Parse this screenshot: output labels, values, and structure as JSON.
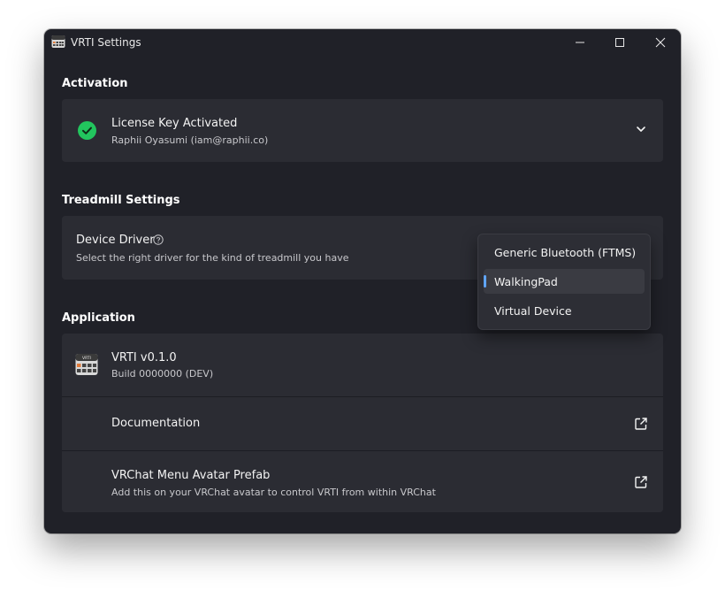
{
  "window": {
    "title": "VRTI Settings"
  },
  "activation": {
    "heading": "Activation",
    "status_title": "License Key Activated",
    "user_line": "Raphii Oyasumi (iam@raphii.co)"
  },
  "treadmill": {
    "heading": "Treadmill Settings",
    "driver_title": "Device Driver",
    "driver_description": "Select the right driver for the kind of treadmill you have",
    "options": [
      {
        "label": "Generic Bluetooth (FTMS)",
        "selected": false
      },
      {
        "label": "WalkingPad",
        "selected": true
      },
      {
        "label": "Virtual Device",
        "selected": false
      }
    ]
  },
  "application": {
    "heading": "Application",
    "app_name": "VRTI v0.1.0",
    "build": "Build 0000000 (DEV)",
    "icon_text": "VRTI",
    "documentation_label": "Documentation",
    "prefab_title": "VRChat Menu Avatar Prefab",
    "prefab_description": "Add this on your VRChat avatar to control VRTI from within VRChat"
  },
  "colors": {
    "window_bg": "#202128",
    "card_bg": "#2b2c33",
    "success": "#22c55e",
    "accent": "#60a5fa"
  }
}
